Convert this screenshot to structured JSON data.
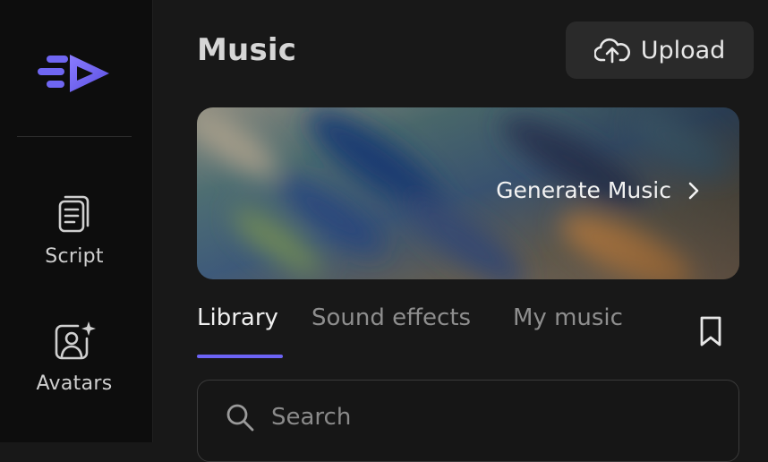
{
  "sidebar": {
    "logo_icon": "play-arrow-logo-icon",
    "items": [
      {
        "label": "Script",
        "icon": "document-icon"
      },
      {
        "label": "Avatars",
        "icon": "user-sparkle-icon"
      }
    ]
  },
  "header": {
    "title": "Music",
    "upload_label": "Upload",
    "upload_icon": "cloud-upload-icon"
  },
  "banner": {
    "label": "Generate Music",
    "icon": "chevron-right-icon"
  },
  "tabs": [
    {
      "label": "Library",
      "active": true
    },
    {
      "label": "Sound effects",
      "active": false
    },
    {
      "label": "My music",
      "active": false
    }
  ],
  "bookmark_icon": "bookmark-icon",
  "search": {
    "placeholder": "Search",
    "icon": "search-icon"
  },
  "colors": {
    "accent": "#6c63f5",
    "background": "#181818",
    "sidebar": "#0d0d0d"
  }
}
